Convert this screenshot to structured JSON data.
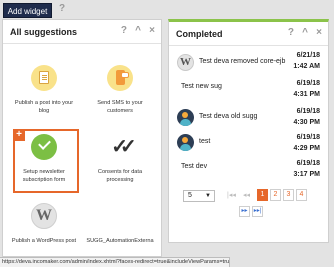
{
  "toolbar": {
    "add_widget_label": "Add widget",
    "help_glyph": "?"
  },
  "suggestions_panel": {
    "title": "All suggestions",
    "controls": {
      "help": "?",
      "collapse": "^",
      "close": "×"
    },
    "items": [
      {
        "label": "Publish a post into your blog",
        "icon": "document-icon"
      },
      {
        "label": "Send SMS to your customers",
        "icon": "sms-phone-icon"
      },
      {
        "label": "Setup newsletter subscription form",
        "icon": "checkmark-icon",
        "highlighted": true,
        "badge": "+"
      },
      {
        "label": "Consents for data processing",
        "icon": "double-check-icon"
      },
      {
        "label": "Publish a WordPress post",
        "icon": "wordpress-icon"
      },
      {
        "label": "SUGG_AutomationExterna",
        "icon": ""
      }
    ]
  },
  "completed_panel": {
    "title": "Completed",
    "controls": {
      "help": "?",
      "collapse": "^",
      "close": "×"
    },
    "items": [
      {
        "name": "Test deva removed core-ejb",
        "date": "6/21/18",
        "time": "1:42 AM",
        "avatar": "wordpress-avatar"
      },
      {
        "name": "Test new sug",
        "date": "6/19/18",
        "time": "4:31 PM",
        "avatar": ""
      },
      {
        "name": "Test deva old sugg",
        "date": "6/19/18",
        "time": "4:30 PM",
        "avatar": "people-avatar"
      },
      {
        "name": "test",
        "date": "6/19/18",
        "time": "4:29 PM",
        "avatar": "people-avatar"
      },
      {
        "name": "Test dev",
        "date": "6/19/18",
        "time": "3:17 PM",
        "avatar": ""
      }
    ],
    "pager": {
      "page_size": "5",
      "pages": [
        "1",
        "2",
        "3",
        "4"
      ],
      "active_page": "1",
      "first": "|◂◂",
      "prev": "◂◂",
      "next": "▸▸",
      "last": "▸▸|"
    }
  },
  "status_url": "https://deva.incomaker.com/admin/index.xhtml?faces-redirect=true&includeViewParams=true&i=0#",
  "colors": {
    "accent": "#e6672a",
    "navy": "#1f2c4c",
    "completed_bar": "#8bc34a"
  }
}
